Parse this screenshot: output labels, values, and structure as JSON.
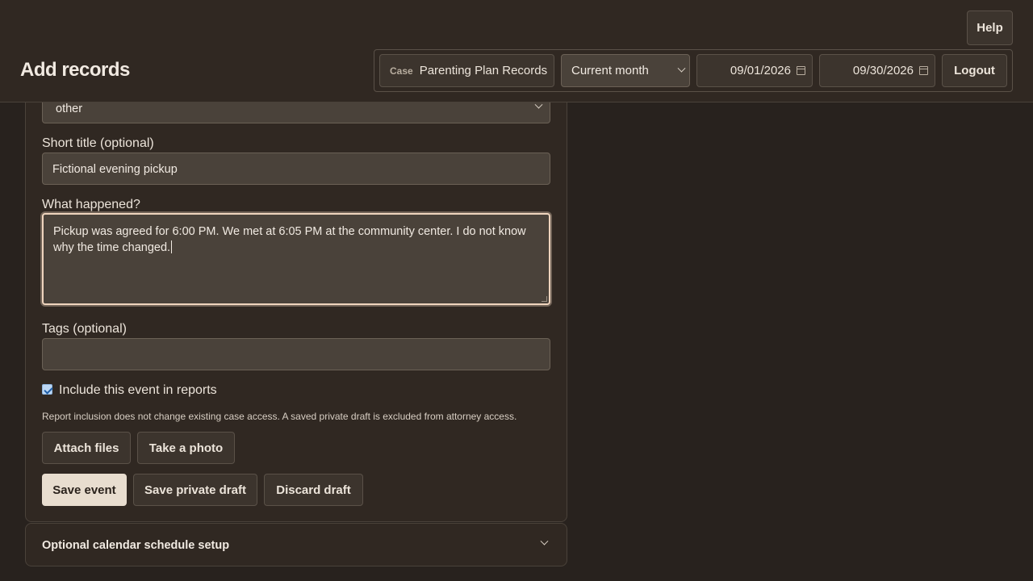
{
  "header": {
    "title": "Add records",
    "help_label": "Help",
    "case_tag": "Case",
    "case_name": "Parenting Plan Records",
    "period_selected": "Current month",
    "start_date": "09/01/2026",
    "end_date": "09/30/2026",
    "logout_label": "Logout"
  },
  "form": {
    "event_type_selected": "other",
    "short_title_label": "Short title (optional)",
    "short_title_value": "Fictional evening pickup",
    "what_happened_label": "What happened?",
    "what_happened_value": "Pickup was agreed for 6:00 PM. We met at 6:05 PM at the community center. I do not know why the time changed.",
    "tags_label": "Tags (optional)",
    "tags_value": "",
    "include_reports_label": "Include this event in reports",
    "include_reports_checked": true,
    "report_note": "Report inclusion does not change existing case access. A saved private draft is excluded from attorney access.",
    "attach_files_label": "Attach files",
    "take_photo_label": "Take a photo",
    "save_event_label": "Save event",
    "save_private_draft_label": "Save private draft",
    "discard_draft_label": "Discard draft"
  },
  "schedule": {
    "label": "Optional calendar schedule setup"
  },
  "icons": {
    "calendar": "calendar-icon",
    "chevron": "chevron-down-icon"
  },
  "colors": {
    "background": "#28221e",
    "panel": "#302822",
    "primary_button": "#e8ddcf",
    "focus_ring": "#efd4bd",
    "checkbox": "#bcd7f4"
  }
}
